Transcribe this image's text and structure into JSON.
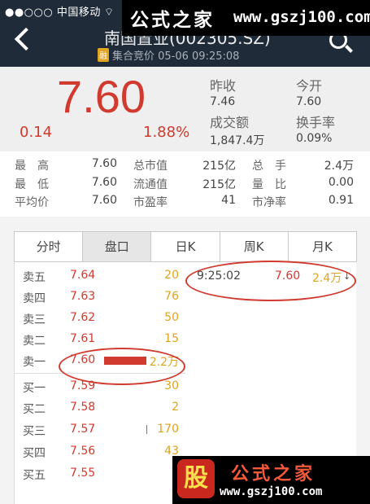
{
  "status_bar": {
    "carrier": "●●○○○ 中国移动",
    "wifi": "⌔"
  },
  "nav": {
    "title": "南国置业(002305.SZ)",
    "badge": "融",
    "subtitle": "集合竞价 05-06 09:25:08"
  },
  "watermark_top": {
    "cn": "公式之家",
    "url": "www.gszj100.com"
  },
  "quote": {
    "price": "7.60",
    "change": "0.14",
    "change_pct": "1.88%",
    "prev_close_label": "昨收",
    "prev_close": "7.46",
    "open_label": "今开",
    "open": "7.60",
    "turnover_label": "成交额",
    "turnover": "1,847.4万",
    "turnover_rate_label": "换手率",
    "turnover_rate": "0.09%"
  },
  "stats": {
    "rows": [
      {
        "l1": "最　高",
        "v1": "7.60",
        "l2": "总市值",
        "v2": "215亿",
        "l3": "总　手",
        "v3": "2.4万"
      },
      {
        "l1": "最　低",
        "v1": "7.60",
        "l2": "流通值",
        "v2": "215亿",
        "l3": "量　比",
        "v3": "0.00"
      },
      {
        "l1": "平均价",
        "v1": "7.60",
        "l2": "市盈率",
        "v2": "41",
        "l3": "市净率",
        "v3": "0.91"
      }
    ]
  },
  "tabs": [
    "分时",
    "盘口",
    "日K",
    "周K",
    "月K"
  ],
  "order_book": [
    {
      "label": "卖五",
      "price": "7.64",
      "vol": "20"
    },
    {
      "label": "卖四",
      "price": "7.63",
      "vol": "76"
    },
    {
      "label": "卖三",
      "price": "7.62",
      "vol": "50"
    },
    {
      "label": "卖二",
      "price": "7.61",
      "vol": "15"
    },
    {
      "label": "卖一",
      "price": "7.60",
      "vol": "2.2万"
    },
    {
      "label": "买一",
      "price": "7.59",
      "vol": "30"
    },
    {
      "label": "买二",
      "price": "7.58",
      "vol": "2"
    },
    {
      "label": "买三",
      "price": "7.57",
      "vol": "170"
    },
    {
      "label": "买四",
      "price": "7.56",
      "vol": "43"
    },
    {
      "label": "买五",
      "price": "7.55",
      "vol": ""
    }
  ],
  "ticks": [
    {
      "time": "9:25:02",
      "price": "7.60",
      "vol": "2.4万",
      "dir": "↓"
    }
  ],
  "watermark_bottom": {
    "logo": "股",
    "cn": "公式之家",
    "url": "www.gszj100.com"
  },
  "colors": {
    "up": "#d03a2f",
    "volume": "#e0a420",
    "nav_bg": "#1f2b38"
  }
}
